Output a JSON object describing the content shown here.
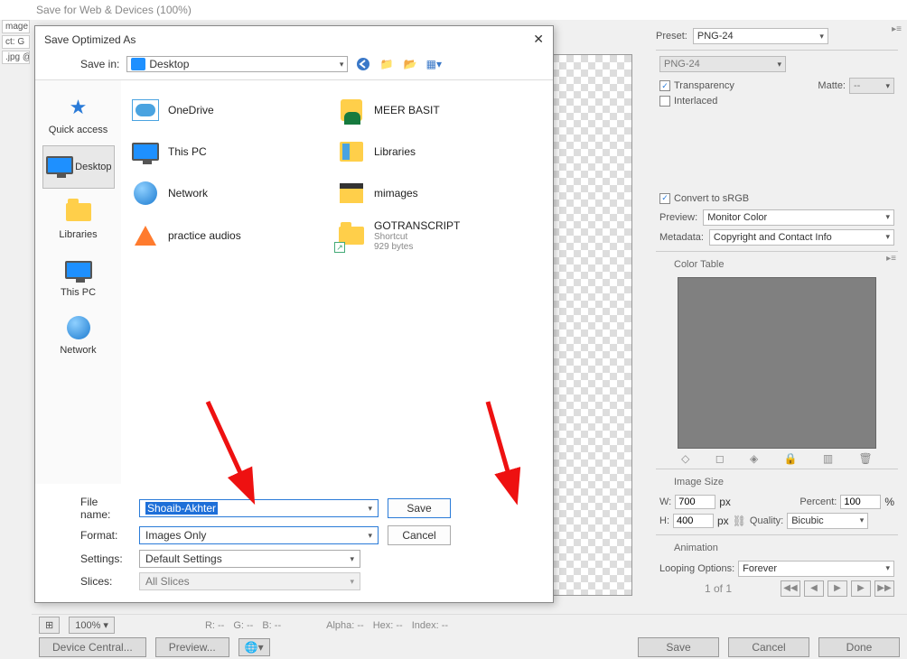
{
  "outer_title": "Save for Web & Devices (100%)",
  "left_strip": [
    "mage",
    "ct: G",
    ".jpg @"
  ],
  "preview_badge": "",
  "right": {
    "preset_label": "Preset:",
    "preset_value": "PNG-24",
    "format_value": "PNG-24",
    "transparency": "Transparency",
    "matte_label": "Matte:",
    "matte_value": "--",
    "interlaced": "Interlaced",
    "convert_srgb": "Convert to sRGB",
    "preview_label": "Preview:",
    "preview_value": "Monitor Color",
    "metadata_label": "Metadata:",
    "metadata_value": "Copyright and Contact Info",
    "color_table": "Color Table",
    "image_size": "Image Size",
    "w_label": "W:",
    "w_value": "700",
    "h_label": "H:",
    "h_value": "400",
    "px": "px",
    "percent_label": "Percent:",
    "percent_value": "100",
    "percent_sym": "%",
    "quality_label": "Quality:",
    "quality_value": "Bicubic",
    "animation": "Animation",
    "loop_label": "Looping Options:",
    "loop_value": "Forever",
    "frame": "1 of 1"
  },
  "bottom": {
    "zoom": "100%",
    "stats": [
      "R: --",
      "G: --",
      "B: --",
      "Alpha: --",
      "Hex: --",
      "Index: --"
    ],
    "device_central": "Device Central...",
    "preview": "Preview...",
    "save": "Save",
    "cancel": "Cancel",
    "done": "Done"
  },
  "dialog": {
    "title": "Save Optimized As",
    "save_in_label": "Save in:",
    "save_in_value": "Desktop",
    "sidebar": [
      {
        "label": "Quick access",
        "kind": "star"
      },
      {
        "label": "Desktop",
        "kind": "monitor",
        "selected": true
      },
      {
        "label": "Libraries",
        "kind": "folder"
      },
      {
        "label": "This PC",
        "kind": "monitor"
      },
      {
        "label": "Network",
        "kind": "globe"
      }
    ],
    "files_left": [
      {
        "label": "OneDrive",
        "kind": "onedrive"
      },
      {
        "label": "This PC",
        "kind": "monitor"
      },
      {
        "label": "Network",
        "kind": "globe"
      },
      {
        "label": "practice audios",
        "kind": "cone"
      }
    ],
    "files_right": [
      {
        "label": "MEER BASIT",
        "kind": "user"
      },
      {
        "label": "Libraries",
        "kind": "lib"
      },
      {
        "label": "mimages",
        "kind": "mfolder"
      },
      {
        "label": "GOTRANSCRIPT",
        "sub1": "Shortcut",
        "sub2": "929 bytes",
        "kind": "folder",
        "shortcut": true
      }
    ],
    "filename_label": "File name:",
    "filename_value": "Shoaib-Akhter",
    "format_label": "Format:",
    "format_value": "Images Only",
    "settings_label": "Settings:",
    "settings_value": "Default Settings",
    "slices_label": "Slices:",
    "slices_value": "All Slices",
    "save": "Save",
    "cancel": "Cancel"
  }
}
